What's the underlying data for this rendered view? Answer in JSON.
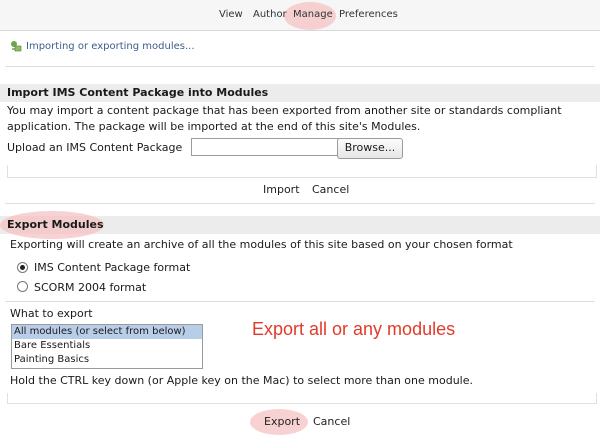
{
  "nav": {
    "items": [
      "View",
      "Author",
      "Manage",
      "Preferences"
    ]
  },
  "status": {
    "text": "Importing or exporting modules..."
  },
  "import": {
    "heading": "Import IMS Content Package into Modules",
    "description": "You may import a content package that has been exported from another site or standards compliant application. The package will be imported at the end of this site's Modules.",
    "upload_label": "Upload an IMS Content Package",
    "file_value": "",
    "browse_label": "Browse...",
    "import_label": "Import",
    "cancel_label": "Cancel"
  },
  "export": {
    "heading": "Export Modules",
    "description": "Exporting will create an archive of all the modules of this site based on your chosen format",
    "formats": [
      {
        "label": "IMS Content Package format",
        "selected": true
      },
      {
        "label": "SCORM 2004 format",
        "selected": false
      }
    ],
    "what_label": "What to export",
    "options": [
      "All modules (or select from below)",
      "Bare Essentials",
      "Painting Basics"
    ],
    "selected_option": "All modules (or select from below)",
    "hint": "Hold the CTRL key down (or Apple key on the Mac) to select more than one module.",
    "annotation": "Export all or any modules",
    "export_label": "Export",
    "cancel_label": "Cancel"
  },
  "colors": {
    "highlight": "#f5c3c3",
    "annotation": "#e23a2a",
    "section_bg": "#ececec"
  }
}
